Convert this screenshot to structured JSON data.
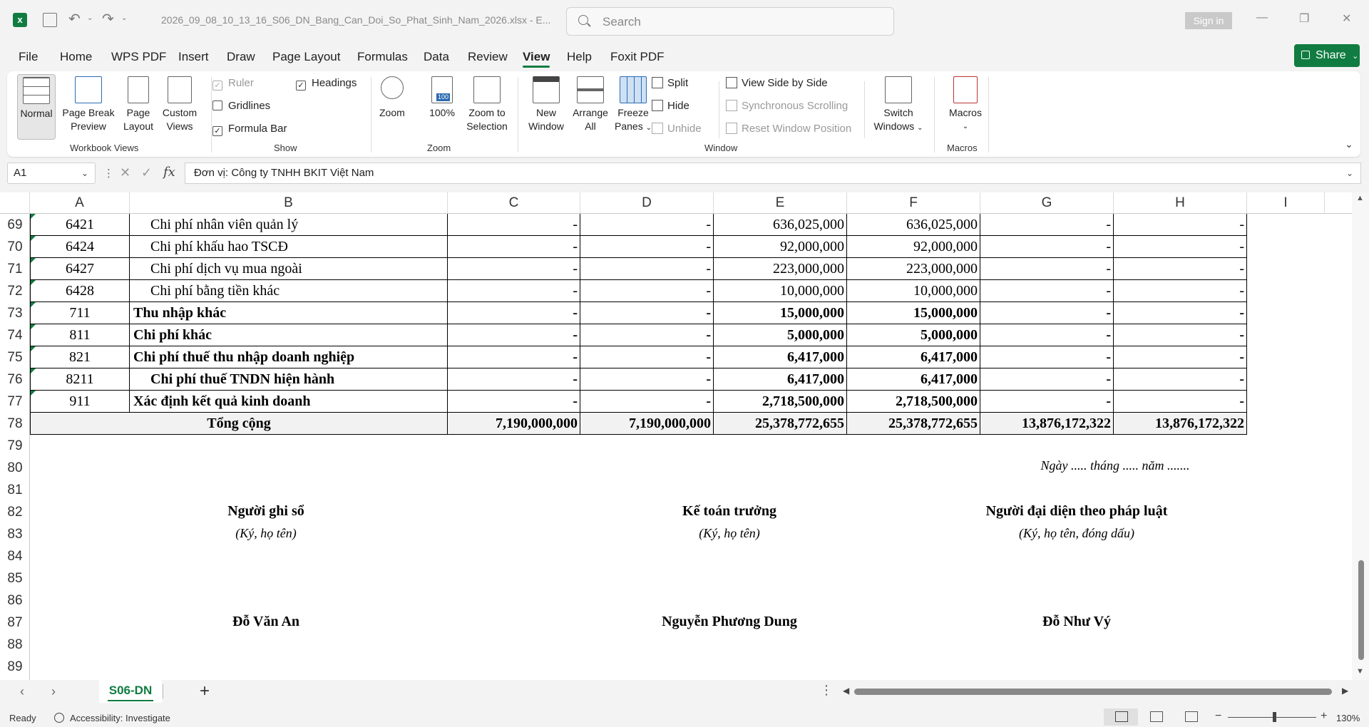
{
  "titlebar": {
    "doc_title": "2026_09_08_10_13_16_S06_DN_Bang_Can_Doi_So_Phat_Sinh_Nam_2026.xlsx  -  E...",
    "search_placeholder": "Search",
    "sign_in": "Sign in"
  },
  "menu": [
    "File",
    "Home",
    "WPS PDF",
    "Insert",
    "Draw",
    "Page Layout",
    "Formulas",
    "Data",
    "Review",
    "View",
    "Help",
    "Foxit PDF"
  ],
  "menu_active": "View",
  "share_label": "Share",
  "ribbon": {
    "workbook_views": {
      "label": "Workbook Views",
      "normal": "Normal",
      "page_break_1": "Page Break",
      "page_break_2": "Preview",
      "page_layout_1": "Page",
      "page_layout_2": "Layout",
      "custom_1": "Custom",
      "custom_2": "Views"
    },
    "show": {
      "label": "Show",
      "ruler": "Ruler",
      "headings": "Headings",
      "gridlines": "Gridlines",
      "formula_bar": "Formula Bar"
    },
    "zoom": {
      "label": "Zoom",
      "zoom": "Zoom",
      "hundred": "100%",
      "sel_1": "Zoom to",
      "sel_2": "Selection",
      "badge": "100"
    },
    "window": {
      "label": "Window",
      "new_1": "New",
      "new_2": "Window",
      "arrange_1": "Arrange",
      "arrange_2": "All",
      "freeze_1": "Freeze",
      "freeze_2": "Panes",
      "split": "Split",
      "hide": "Hide",
      "unhide": "Unhide",
      "side_by_side": "View Side by Side",
      "sync_scroll": "Synchronous Scrolling",
      "reset_pos": "Reset Window Position",
      "switch_1": "Switch",
      "switch_2": "Windows"
    },
    "macros": {
      "label": "Macros",
      "macros": "Macros"
    }
  },
  "formula_bar": {
    "name_box": "A1",
    "content": "Đơn vị: Công ty TNHH BKIT Việt Nam"
  },
  "columns": [
    "A",
    "B",
    "C",
    "D",
    "E",
    "F",
    "G",
    "H",
    "I"
  ],
  "row_numbers": [
    "69",
    "70",
    "71",
    "72",
    "73",
    "74",
    "75",
    "76",
    "77",
    "78",
    "79",
    "80",
    "81",
    "82",
    "83",
    "84",
    "85",
    "86",
    "87",
    "88",
    "89"
  ],
  "table_rows": [
    {
      "a": "6421",
      "b": "Chi phí nhân viên quản lý",
      "c": "-",
      "d": "-",
      "e": "636,025,000",
      "f": "636,025,000",
      "g": "-",
      "h": "-",
      "bold": false,
      "indent": true
    },
    {
      "a": "6424",
      "b": "Chi phí khấu hao TSCĐ",
      "c": "-",
      "d": "-",
      "e": "92,000,000",
      "f": "92,000,000",
      "g": "-",
      "h": "-",
      "bold": false,
      "indent": true
    },
    {
      "a": "6427",
      "b": "Chi phí dịch vụ mua ngoài",
      "c": "-",
      "d": "-",
      "e": "223,000,000",
      "f": "223,000,000",
      "g": "-",
      "h": "-",
      "bold": false,
      "indent": true
    },
    {
      "a": "6428",
      "b": "Chi phí bằng tiền khác",
      "c": "-",
      "d": "-",
      "e": "10,000,000",
      "f": "10,000,000",
      "g": "-",
      "h": "-",
      "bold": false,
      "indent": true
    },
    {
      "a": "711",
      "b": "Thu nhập khác",
      "c": "-",
      "d": "-",
      "e": "15,000,000",
      "f": "15,000,000",
      "g": "-",
      "h": "-",
      "bold": true,
      "indent": false
    },
    {
      "a": "811",
      "b": "Chi phí khác",
      "c": "-",
      "d": "-",
      "e": "5,000,000",
      "f": "5,000,000",
      "g": "-",
      "h": "-",
      "bold": true,
      "indent": false
    },
    {
      "a": "821",
      "b": "Chi phí thuế thu nhập doanh nghiệp",
      "c": "-",
      "d": "-",
      "e": "6,417,000",
      "f": "6,417,000",
      "g": "-",
      "h": "-",
      "bold": true,
      "indent": false
    },
    {
      "a": "8211",
      "b": "Chi phí thuế TNDN hiện hành",
      "c": "-",
      "d": "-",
      "e": "6,417,000",
      "f": "6,417,000",
      "g": "-",
      "h": "-",
      "bold": true,
      "indent": true
    },
    {
      "a": "911",
      "b": "Xác định kết quả kinh doanh",
      "c": "-",
      "d": "-",
      "e": "2,718,500,000",
      "f": "2,718,500,000",
      "g": "-",
      "h": "-",
      "bold": true,
      "indent": false
    }
  ],
  "total_row": {
    "label": "Tổng cộng",
    "c": "7,190,000,000",
    "d": "7,190,000,000",
    "e": "25,378,772,655",
    "f": "25,378,772,655",
    "g": "13,876,172,322",
    "h": "13,876,172,322"
  },
  "signatures": {
    "date_line": "Ngày ..... tháng ..... năm .......",
    "preparer_title": "Người ghi sổ",
    "preparer_note": "(Ký, họ tên)",
    "preparer_name": "Đỗ Văn An",
    "accountant_title": "Kế toán trưởng",
    "accountant_note": "(Ký, họ tên)",
    "accountant_name": "Nguyễn Phương Dung",
    "legal_title": "Người đại diện theo pháp luật",
    "legal_note": "(Ký, họ tên, đóng dấu)",
    "legal_name": "Đỗ Như Vý"
  },
  "sheet_tab": "S06-DN",
  "status": {
    "ready": "Ready",
    "accessibility": "Accessibility: Investigate",
    "zoom_level": "130%"
  },
  "colors": {
    "accent": "#107c41"
  }
}
